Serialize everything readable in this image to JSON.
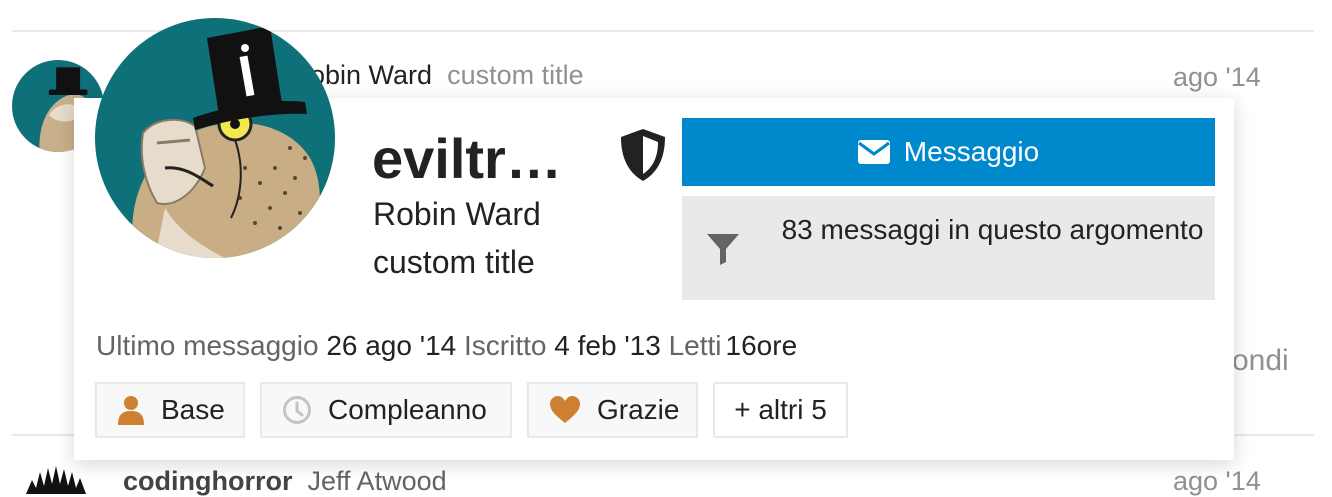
{
  "post_above": {
    "name_visible": "obin Ward",
    "user_title": "custom title",
    "date": "ago '14"
  },
  "right_fragment": "ondi",
  "post_below": {
    "username": "codinghorror",
    "name": "Jeff Atwood",
    "date": "ago '14"
  },
  "card": {
    "username": "eviltr…",
    "name": "Robin Ward",
    "title": "custom title",
    "message_button": "Messaggio",
    "filter_button": "83 messaggi in questo argomento",
    "stats": {
      "last_post_label": "Ultimo messaggio",
      "last_post_value": "26 ago '14",
      "joined_label": "Iscritto",
      "joined_value": "4 feb '13",
      "read_label": "Letti",
      "read_value": "16ore"
    },
    "badges": [
      {
        "label": "Base",
        "icon": "user-icon",
        "color": "#cd7f32"
      },
      {
        "label": "Compleanno",
        "icon": "clock-icon",
        "color": "#c4c4c4"
      },
      {
        "label": "Grazie",
        "icon": "heart-icon",
        "color": "#cd7f32"
      }
    ],
    "more_badges": "+ altri 5"
  },
  "colors": {
    "primary": "#0088cc",
    "bronze": "#cd7f32",
    "avatar_bg": "#0e7078"
  }
}
